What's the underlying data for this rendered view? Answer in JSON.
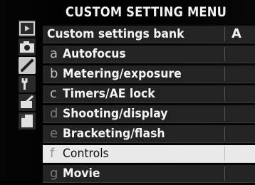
{
  "menu": {
    "title": "CUSTOM SETTING MENU",
    "bank": {
      "label": "Custom settings bank",
      "value": "A"
    },
    "items": [
      {
        "letter": "a",
        "label": "Autofocus"
      },
      {
        "letter": "b",
        "label": "Metering/exposure"
      },
      {
        "letter": "c",
        "label": "Timers/AE lock"
      },
      {
        "letter": "d",
        "label": "Shooting/display"
      },
      {
        "letter": "e",
        "label": "Bracketing/flash"
      },
      {
        "letter": "f",
        "label": "Controls"
      },
      {
        "letter": "g",
        "label": "Movie"
      }
    ],
    "selected_item": "Controls"
  },
  "sidebar": {
    "tabs": [
      {
        "icon": "playback-icon"
      },
      {
        "icon": "camera-icon"
      },
      {
        "icon": "pencil-icon",
        "active": true
      },
      {
        "icon": "wrench-icon"
      },
      {
        "icon": "retouch-icon"
      },
      {
        "icon": "my-menu-icon"
      }
    ]
  },
  "colors": {
    "background": "#000000",
    "row": "#232323",
    "selected_row": "#e9e9e9",
    "text": "#f4f4f4"
  }
}
